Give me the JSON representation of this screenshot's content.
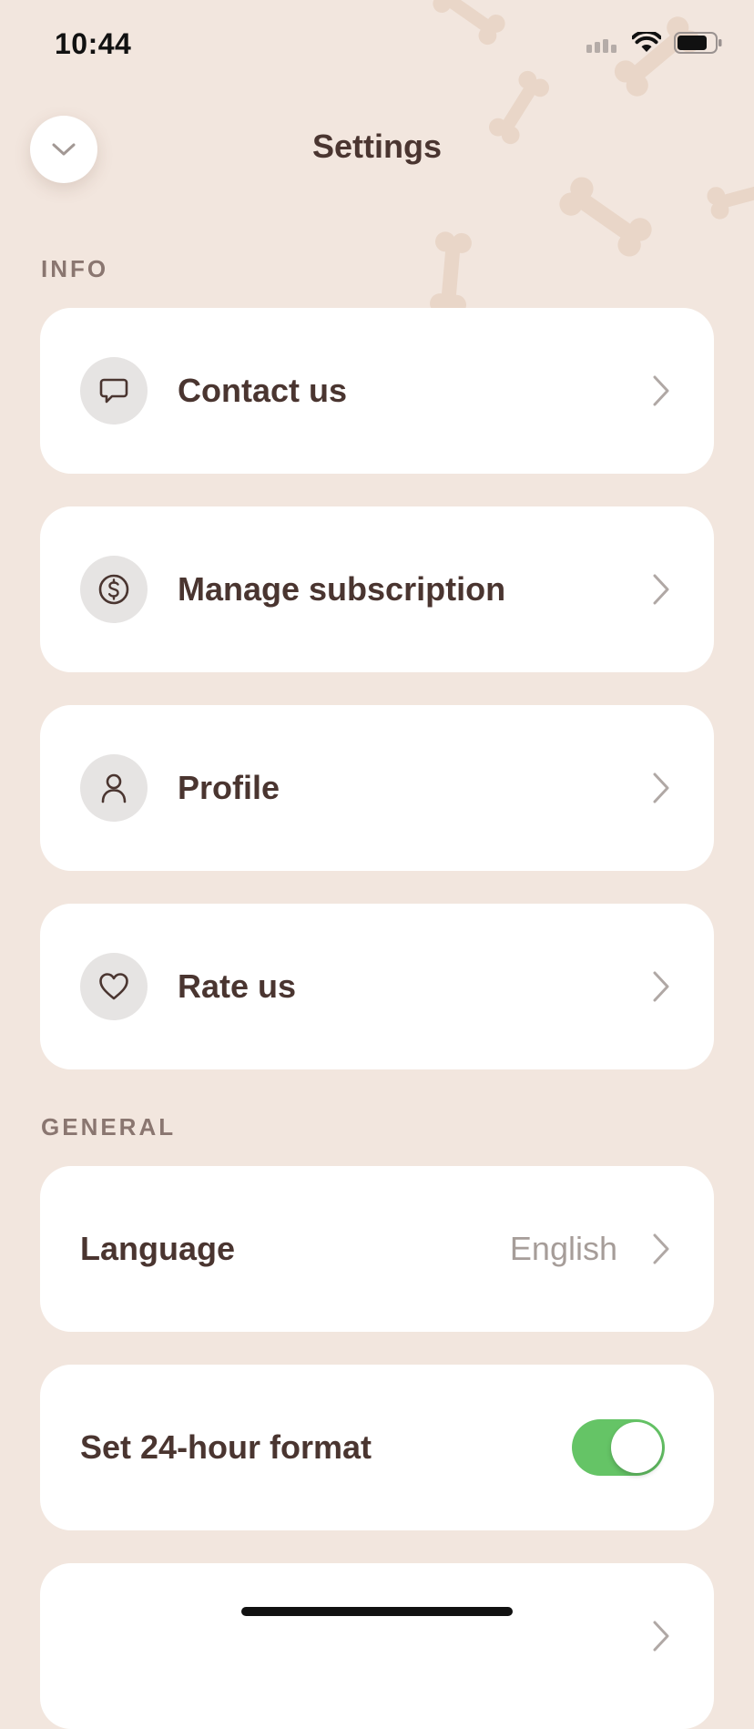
{
  "status_bar": {
    "time": "10:44"
  },
  "header": {
    "title": "Settings",
    "back_icon": "chevron-down-icon"
  },
  "sections": {
    "info": {
      "title": "INFO",
      "items": [
        {
          "label": "Contact us",
          "icon": "chat-bubble-icon"
        },
        {
          "label": "Manage subscription",
          "icon": "dollar-circle-icon"
        },
        {
          "label": "Profile",
          "icon": "person-icon"
        },
        {
          "label": "Rate us",
          "icon": "heart-icon"
        }
      ]
    },
    "general": {
      "title": "GENERAL",
      "language": {
        "label": "Language",
        "value": "English"
      },
      "time_format": {
        "label": "Set 24-hour format",
        "enabled": true
      }
    }
  },
  "colors": {
    "background": "#f2e6de",
    "card": "#ffffff",
    "text": "#4a3530",
    "section_header": "#8a7670",
    "toggle_on": "#65c466",
    "bone_pattern": "#e9d6c8"
  }
}
